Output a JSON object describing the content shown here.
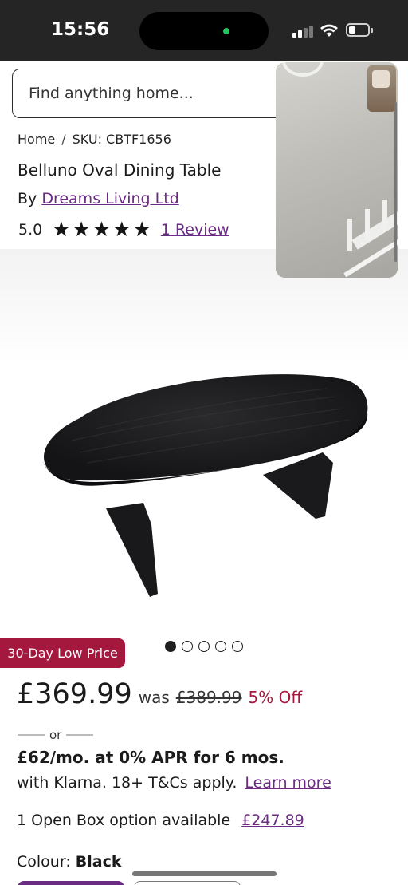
{
  "status_bar": {
    "time": "15:56",
    "icons": [
      "signal-icon",
      "wifi-icon",
      "battery-icon"
    ]
  },
  "search": {
    "placeholder": "Find anything home..."
  },
  "breadcrumb": {
    "items": [
      "Home",
      "SKU: CBTF1656"
    ],
    "separator": "/"
  },
  "product": {
    "title": "Belluno Oval Dining Table",
    "by_label": "By",
    "seller": "Dreams Living Ltd",
    "rating_value": "5.0",
    "stars": 5,
    "reviews_link": "1 Review",
    "image_alt_icon": "dining-table-image",
    "carousel_total": 5,
    "carousel_active": 1
  },
  "pricing": {
    "badge": "30-Day Low Price",
    "price": "£369.99",
    "was_label": "was",
    "was_price": "£389.99",
    "discount": "5% Off",
    "or_label": "or",
    "klarna_line1": "£62/mo. at 0% APR for 6 mos.",
    "klarna_line2": "with Klarna. 18+ T&Cs apply.",
    "learn_more": "Learn more",
    "open_box_text": "1 Open Box option available",
    "open_box_price": "£247.89"
  },
  "options": {
    "colour_label": "Colour:",
    "colour_value": "Black"
  },
  "colors": {
    "accent_link": "#6a2b83",
    "badge_red": "#a3183c",
    "status_bar_bg": "#252525"
  }
}
